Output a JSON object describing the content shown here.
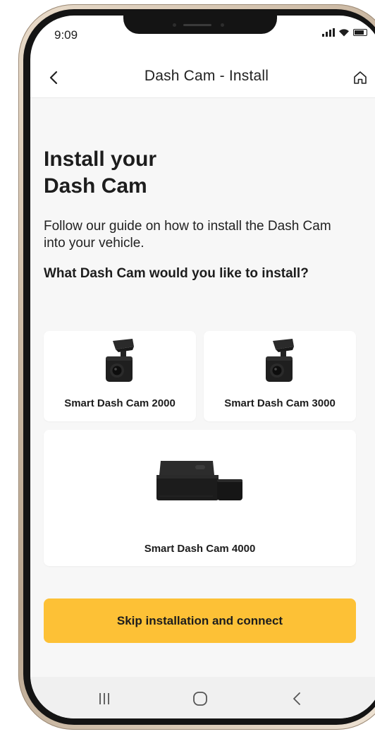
{
  "status_bar": {
    "time": "9:09"
  },
  "nav": {
    "title": "Dash Cam - Install",
    "back_icon": "chevron-left-icon",
    "home_icon": "home-icon"
  },
  "page": {
    "title_line1": "Install your",
    "title_line2": "Dash Cam",
    "description": "Follow our guide on how to install the Dash Cam into your vehicle.",
    "question": "What Dash Cam would you like to install?"
  },
  "cameras": [
    {
      "name": "Smart Dash Cam 2000",
      "icon": "dash-cam-small-icon"
    },
    {
      "name": "Smart Dash Cam 3000",
      "icon": "dash-cam-small-icon"
    },
    {
      "name": "Smart Dash Cam 4000",
      "icon": "dash-cam-large-icon"
    }
  ],
  "cta": {
    "label": "Skip installation and connect"
  },
  "system_nav": {
    "recents_icon": "recents-icon",
    "home_icon": "home-circle-icon",
    "back_icon": "back-chevron-icon"
  },
  "colors": {
    "accent": "#fdc136",
    "background": "#f7f7f7",
    "card": "#ffffff",
    "text": "#1d1d1d"
  }
}
